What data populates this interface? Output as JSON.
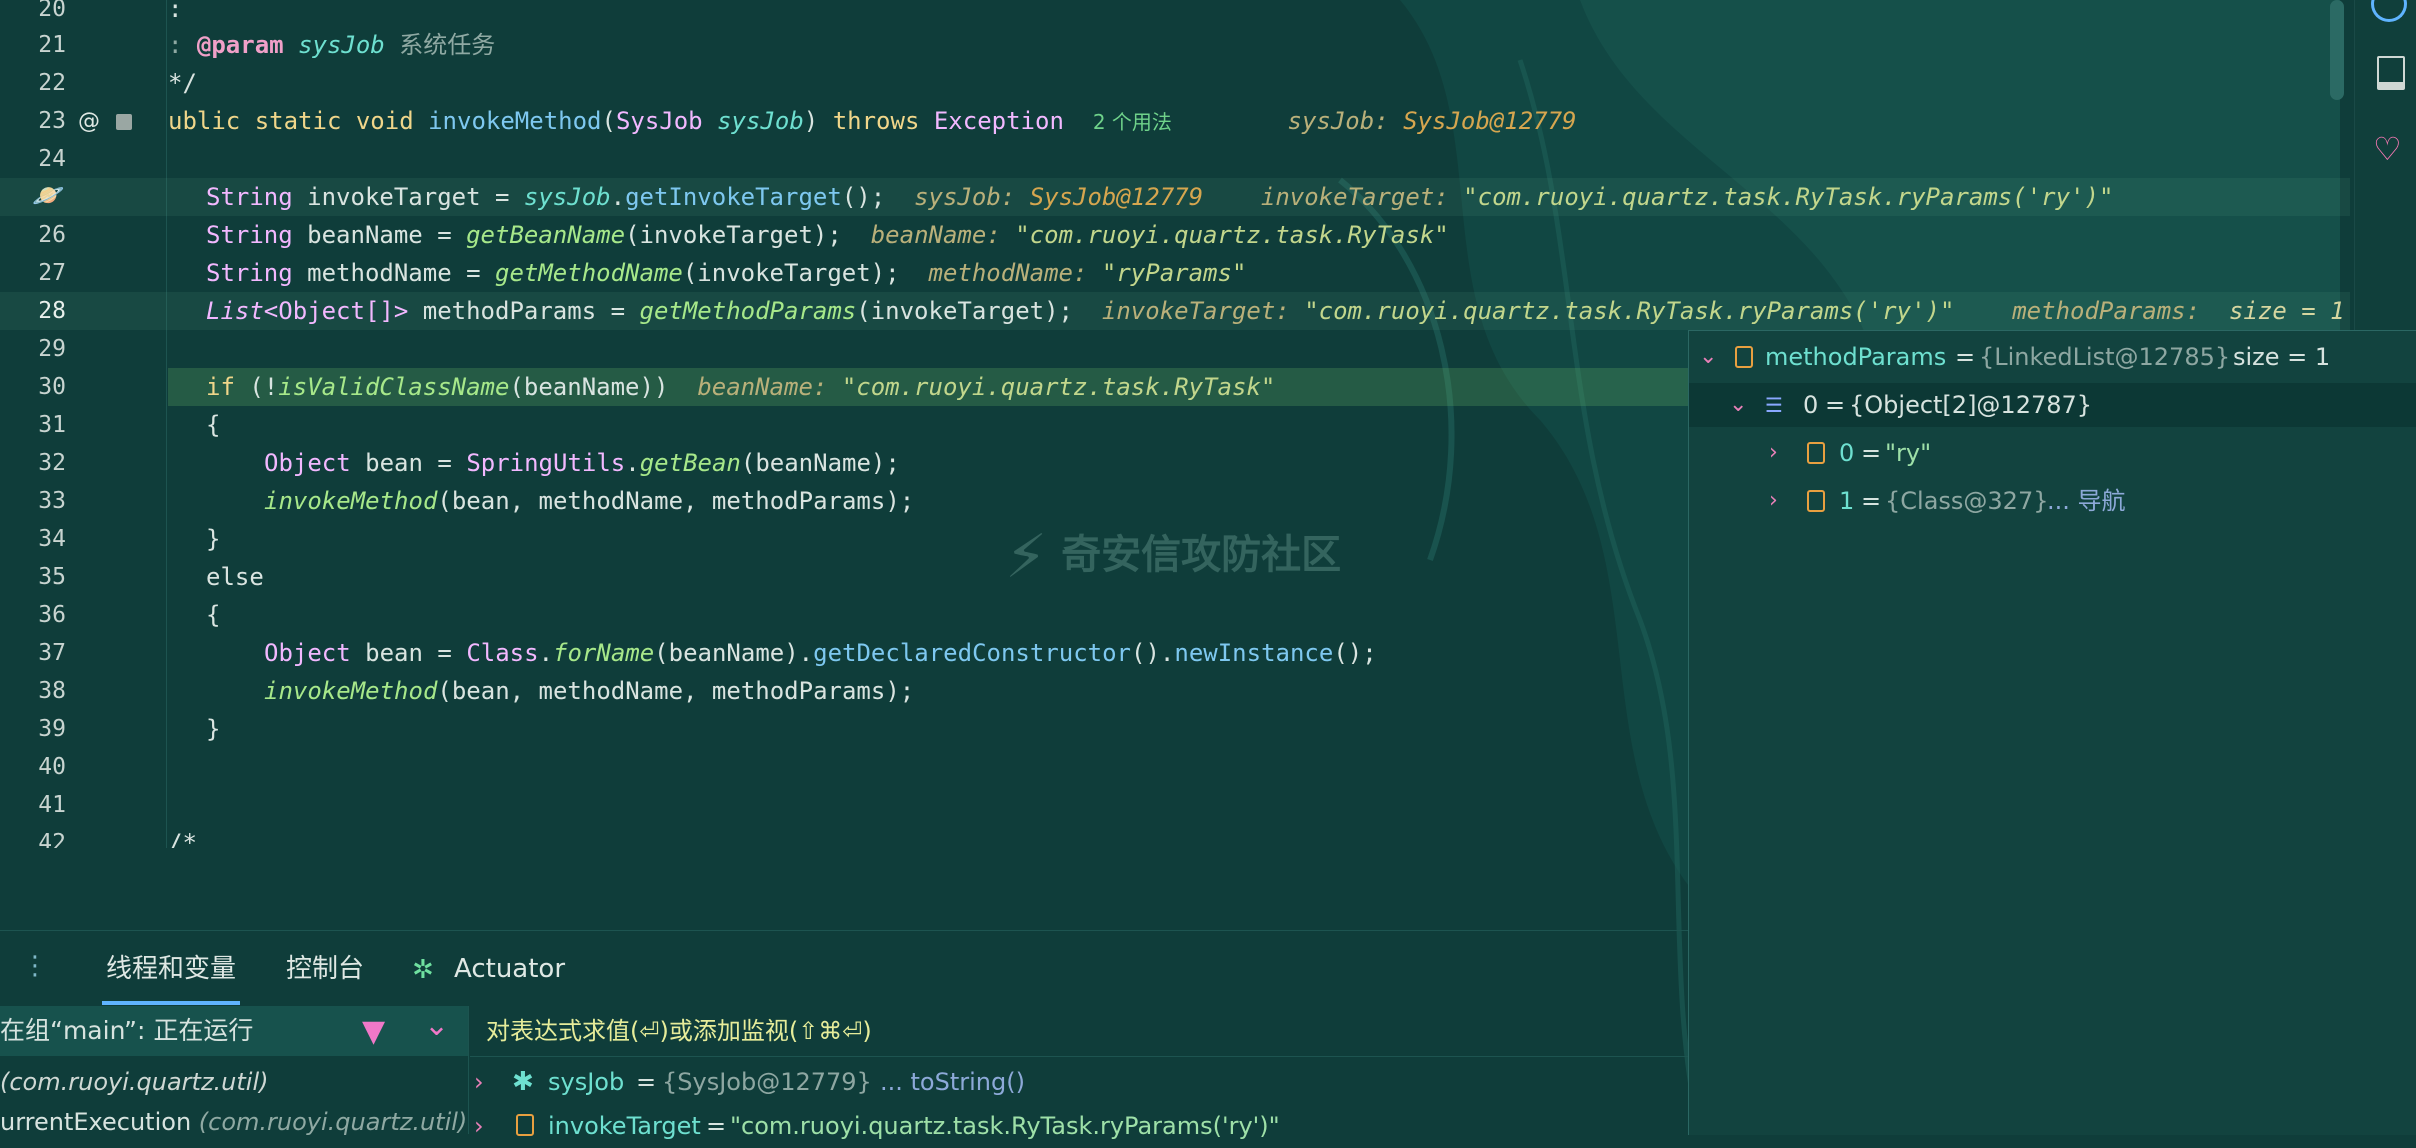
{
  "editor": {
    "lines": [
      {
        "num": "20",
        "code": ":"
      },
      {
        "num": "21",
        "annotation": "@param",
        "param": "sysJob",
        "comment": "系统任务"
      },
      {
        "num": "22",
        "code": "*/"
      },
      {
        "num": "23",
        "kw": "ublic static void",
        "fn": "invokeMethod",
        "open": "(",
        "type": "SysJob",
        "param": "sysJob",
        "close": ")",
        "throws": "throws",
        "exc": "Exception",
        "usage": "2 个用法",
        "hint_label": "sysJob:",
        "hint_value": "SysJob@12779"
      },
      {
        "num": "24"
      },
      {
        "num": "25",
        "type": "String",
        "name": "invokeTarget =",
        "obj": "sysJob",
        "dot": ".",
        "call": "getInvokeTarget",
        "rest": "();",
        "hint1_label": "sysJob:",
        "hint1_value": "SysJob@12779",
        "hint2_label": "invokeTarget:",
        "hint2_value": "\"com.ruoyi.quartz.task.RyTask.ryParams('ry')\""
      },
      {
        "num": "26",
        "type": "String",
        "name": "beanName =",
        "call": "getBeanName",
        "rest": "(invokeTarget);",
        "hint_label": "beanName:",
        "hint_value": "\"com.ruoyi.quartz.task.RyTask\""
      },
      {
        "num": "27",
        "type": "String",
        "name": "methodName =",
        "call": "getMethodName",
        "rest": "(invokeTarget);",
        "hint_label": "methodName:",
        "hint_value": "\"ryParams\""
      },
      {
        "num": "28",
        "type": "List",
        "gen": "<Object[]>",
        "name": "methodParams =",
        "call": "getMethodParams",
        "rest": "(invokeTarget);",
        "hint1_label": "invokeTarget:",
        "hint1_value": "\"com.ruoyi.quartz.task.RyTask.ryParams('ry')\"",
        "hint2_label": "methodParams:",
        "hint2_value": "size = 1"
      },
      {
        "num": "29"
      },
      {
        "num": "30",
        "kw": "if",
        "pre": "(!",
        "call": "isValidClassName",
        "rest": "(beanName))",
        "hint_label": "beanName:",
        "hint_value": "\"com.ruoyi.quartz.task.RyTask\""
      },
      {
        "num": "31",
        "code": "{"
      },
      {
        "num": "32",
        "type": "Object",
        "name": "bean =",
        "cls": "SpringUtils",
        "dot": ".",
        "call": "getBean",
        "rest": "(beanName);"
      },
      {
        "num": "33",
        "call": "invokeMethod",
        "rest": "(bean, methodName, methodParams);"
      },
      {
        "num": "34",
        "code": "}"
      },
      {
        "num": "35",
        "kw": "else"
      },
      {
        "num": "36",
        "code": "{"
      },
      {
        "num": "37",
        "type": "Object",
        "name": "bean =",
        "cls": "Class",
        "dot": ".",
        "call": "forName",
        "mid": "(beanName).",
        "call2": "getDeclaredConstructor",
        "mid2": "().",
        "call3": "newInstance",
        "rest": "();"
      },
      {
        "num": "38",
        "call": "invokeMethod",
        "rest": "(bean, methodName, methodParams);"
      },
      {
        "num": "39",
        "code": "}"
      },
      {
        "num": "40"
      },
      {
        "num": "41"
      },
      {
        "num": "42",
        "code": "/*"
      }
    ]
  },
  "popup": {
    "root": {
      "name": "methodParams",
      "eq": "=",
      "type": "{LinkedList@12785}",
      "size": "size = 1"
    },
    "child": {
      "name": "0",
      "eq": "=",
      "value": "{Object[2]@12787}"
    },
    "items": [
      {
        "name": "0",
        "eq": "=",
        "value": "\"ry\""
      },
      {
        "name": "1",
        "eq": "=",
        "value": "{Class@327}",
        "link": "... 导航"
      }
    ]
  },
  "watermark": "奇安信攻防社区",
  "bottom": {
    "tabs": [
      "线程和变量",
      "控制台",
      "Actuator"
    ],
    "thread": "在组“main”: 正在运行",
    "frames": [
      {
        "pkg": "(com.ruoyi.quartz.util)"
      },
      {
        "method": "urrentExecution",
        "pkg": "(com.ruoyi.quartz.util)"
      }
    ],
    "eval_placeholder": "对表达式求值(⏎)或添加监视(⇧⌘⏎)",
    "vars": [
      {
        "name": "sysJob",
        "eq": "=",
        "value": "{SysJob@12779}",
        "extra": "... toString()"
      },
      {
        "name": "invokeTarget",
        "eq": "=",
        "value": "\"com.ruoyi.quartz.task.RyTask.ryParams('ry')\""
      }
    ]
  },
  "colors": {
    "bg": "#0f3d3a",
    "exec_line": "#3e7a4e",
    "accent": "#5fb4ff",
    "pink": "#e880b8"
  }
}
